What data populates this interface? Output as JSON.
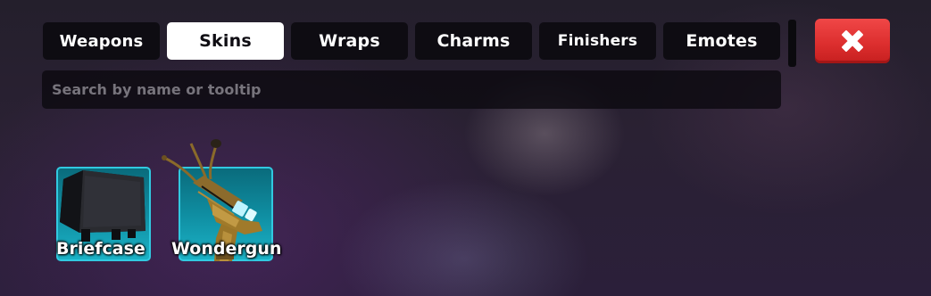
{
  "tabs": [
    {
      "label": "Weapons",
      "active": false
    },
    {
      "label": "Skins",
      "active": true
    },
    {
      "label": "Wraps",
      "active": false
    },
    {
      "label": "Charms",
      "active": false
    },
    {
      "label": "Finishers",
      "active": false
    },
    {
      "label": "Emotes",
      "active": false
    }
  ],
  "close_button": {
    "icon": "close-x-icon",
    "color": "#e03434"
  },
  "search": {
    "placeholder": "Search by name or tooltip",
    "value": ""
  },
  "items": [
    {
      "name": "Briefcase",
      "icon": "briefcase-icon",
      "border_color": "#31c9e0"
    },
    {
      "name": "Wondergun",
      "icon": "wondergun-icon",
      "border_color": "#31c9e0"
    }
  ],
  "colors": {
    "tab_bg": "#0e0c12",
    "tab_active_bg": "#ffffff",
    "card_bg": "#0f8da1",
    "close_red": "#e03434"
  }
}
